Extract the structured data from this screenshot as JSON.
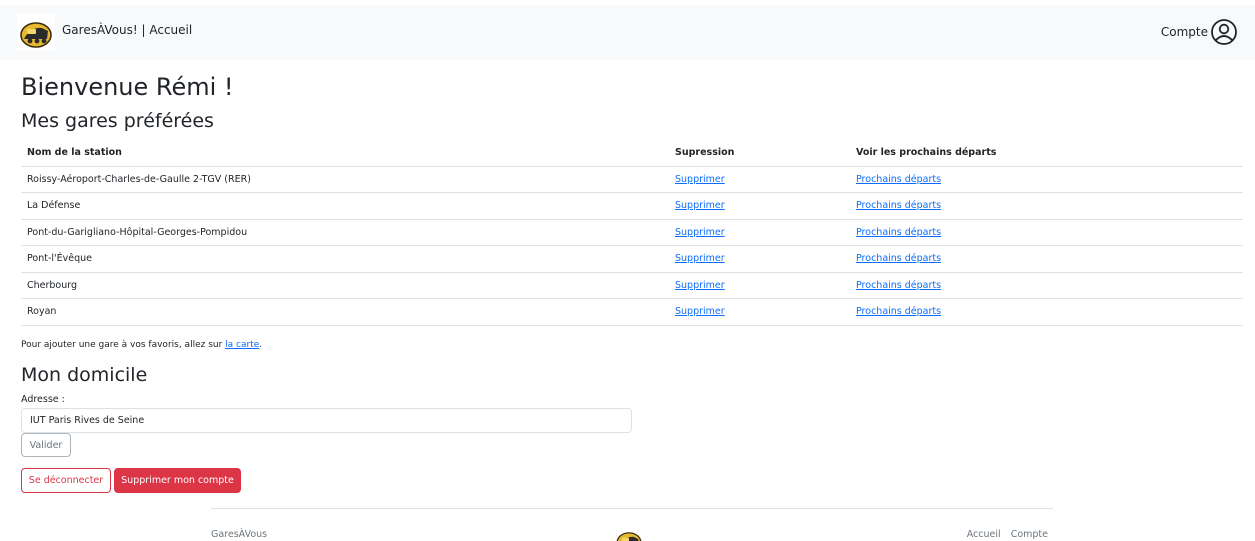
{
  "navbar": {
    "brand": "GaresÀVous! | Accueil",
    "account_label": "Compte",
    "logo_icon": "gold-locomotive-logo-icon",
    "account_icon": "user-circle-icon"
  },
  "welcome": "Bienvenue Rémi !",
  "favorites": {
    "title": "Mes gares préférées",
    "columns": [
      "Nom de la station",
      "Supression",
      "Voir les prochains départs"
    ],
    "rows": [
      {
        "name": "Roissy-Aéroport-Charles-de-Gaulle 2-TGV (RER)",
        "delete": "Supprimer",
        "departures": "Prochains départs"
      },
      {
        "name": "La Défense",
        "delete": "Supprimer",
        "departures": "Prochains départs"
      },
      {
        "name": "Pont-du-Garigliano-Hôpital-Georges-Pompidou",
        "delete": "Supprimer",
        "departures": "Prochains départs"
      },
      {
        "name": "Pont-l'Évêque",
        "delete": "Supprimer",
        "departures": "Prochains départs"
      },
      {
        "name": "Cherbourg",
        "delete": "Supprimer",
        "departures": "Prochains départs"
      },
      {
        "name": "Royan",
        "delete": "Supprimer",
        "departures": "Prochains départs"
      }
    ],
    "hint_prefix": "Pour ajouter une gare à vos favoris, allez sur ",
    "hint_link": "la carte",
    "hint_suffix": "."
  },
  "home": {
    "title": "Mon domicile",
    "address_label": "Adresse :",
    "address_value": "IUT Paris Rives de Seine",
    "validate_label": "Valider"
  },
  "actions": {
    "logout_label": "Se déconnecter",
    "delete_account_label": "Supprimer mon compte"
  },
  "footer": {
    "brand": "GaresÀVous",
    "links": [
      "Accueil",
      "Compte"
    ]
  },
  "colors": {
    "link": "#0d6efd",
    "danger": "#dc3545",
    "navbar_bg": "#f8f9fa",
    "logo_gold": "#e8b830"
  }
}
